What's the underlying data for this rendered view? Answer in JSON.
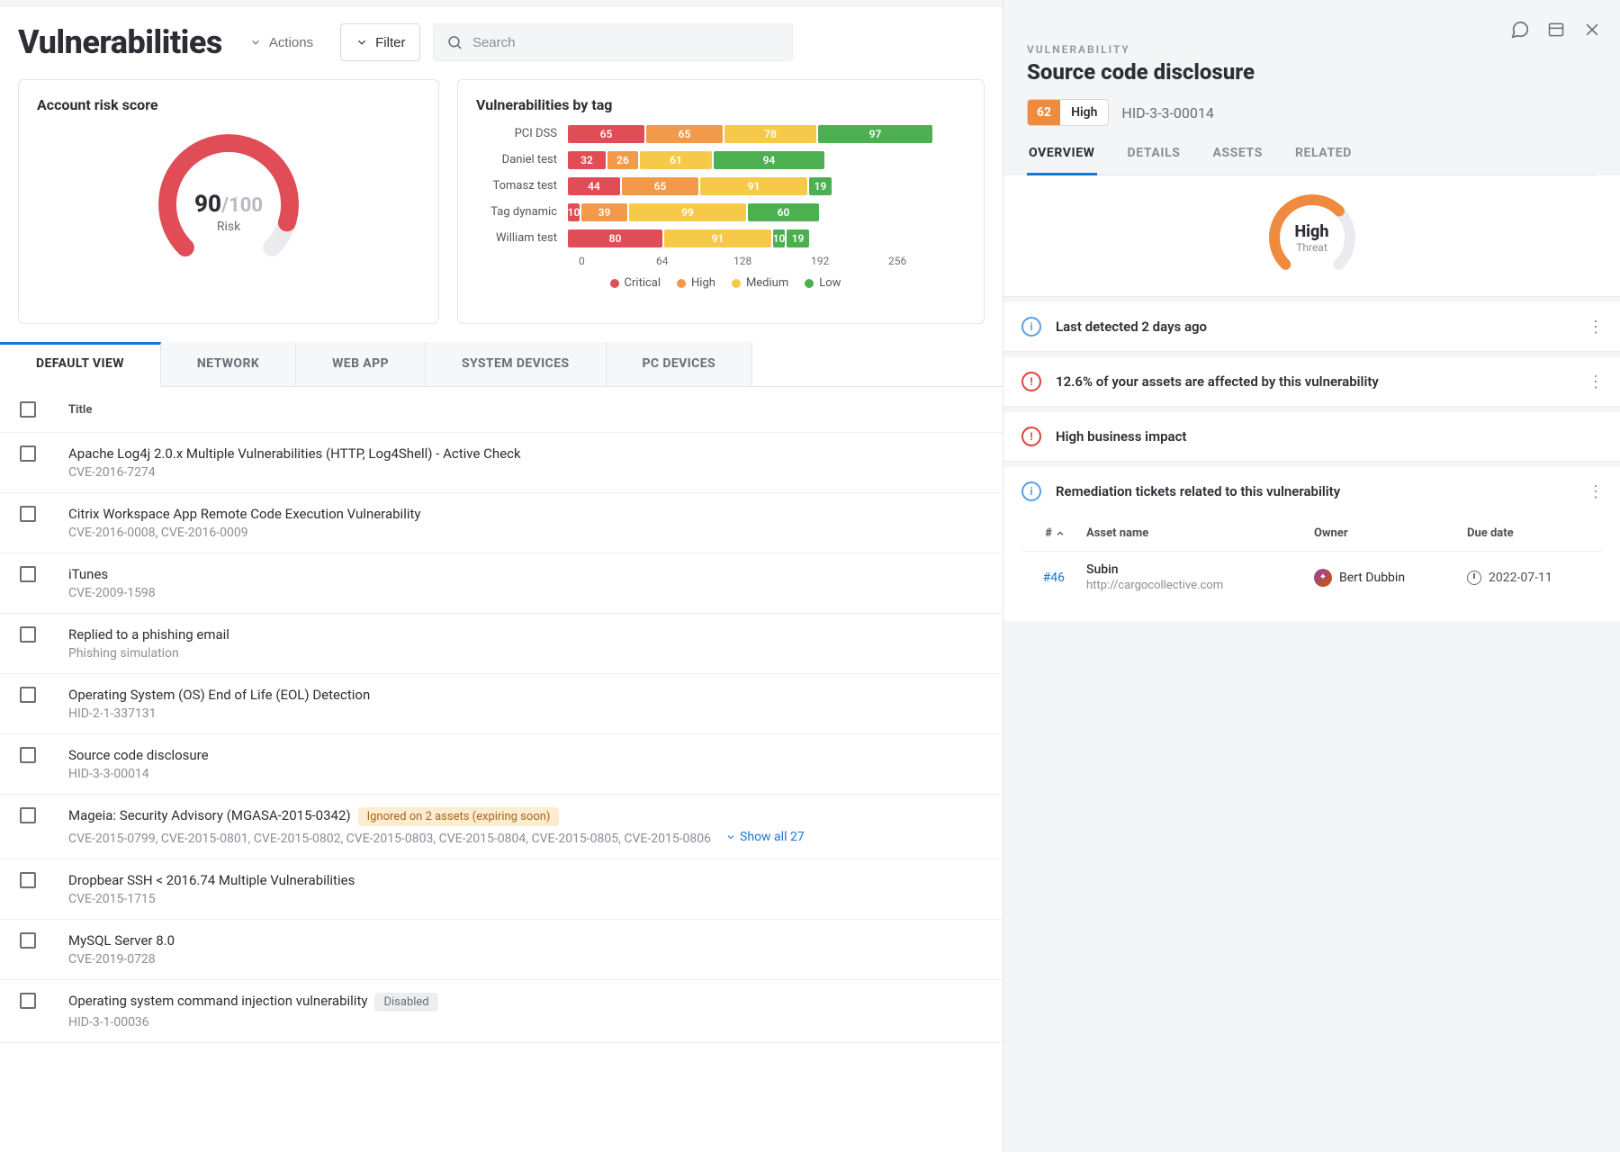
{
  "header": {
    "title": "Vulnerabilities",
    "actions_label": "Actions",
    "filter_label": "Filter",
    "search_placeholder": "Search"
  },
  "risk_card": {
    "title": "Account risk score",
    "score": "90",
    "score_max": "/100",
    "risk_label": "Risk"
  },
  "tags_card": {
    "title": "Vulnerabilities by tag",
    "rows": [
      {
        "label": "PCI DSS",
        "crit": 65,
        "high": 65,
        "med": 78,
        "low": 97
      },
      {
        "label": "Daniel test",
        "crit": 32,
        "high": 26,
        "med": 61,
        "low": 94
      },
      {
        "label": "Tomasz test",
        "crit": 44,
        "high": 65,
        "med": 91,
        "low": 19
      },
      {
        "label": "Tag dynamic",
        "crit": 10,
        "high": 39,
        "med": 99,
        "low": 60
      },
      {
        "label": "William test",
        "crit": 80,
        "high": 0,
        "med": 91,
        "low_a": 10,
        "low_b": 19
      }
    ],
    "axis": [
      "0",
      "64",
      "128",
      "192",
      "256"
    ],
    "legend": {
      "crit": "Critical",
      "high": "High",
      "med": "Medium",
      "low": "Low"
    }
  },
  "chart_data": {
    "type": "bar",
    "stacked": true,
    "orientation": "horizontal",
    "title": "Vulnerabilities by tag",
    "xlabel": "",
    "ylabel": "",
    "xlim": [
      0,
      256
    ],
    "x_ticks": [
      0,
      64,
      128,
      192,
      256
    ],
    "categories": [
      "PCI DSS",
      "Daniel test",
      "Tomasz test",
      "Tag dynamic",
      "William test"
    ],
    "series": [
      {
        "name": "Critical",
        "color": "#e14d57",
        "values": [
          65,
          32,
          44,
          10,
          80
        ]
      },
      {
        "name": "High",
        "color": "#f2994a",
        "values": [
          65,
          26,
          65,
          39,
          0
        ]
      },
      {
        "name": "Medium",
        "color": "#f7c948",
        "values": [
          78,
          61,
          91,
          99,
          91
        ]
      },
      {
        "name": "Low",
        "color": "#4caf50",
        "values": [
          97,
          94,
          19,
          60,
          29
        ]
      }
    ],
    "legend_position": "bottom",
    "note": "William test low segment rendered as two sub-blocks labeled 10 and 19"
  },
  "tabs": {
    "default": "DEFAULT VIEW",
    "network": "NETWORK",
    "webapp": "WEB APP",
    "system": "SYSTEM DEVICES",
    "pc": "PC DEVICES"
  },
  "table": {
    "head_title": "Title",
    "rows": [
      {
        "title": "Apache Log4j 2.0.x Multiple Vulnerabilities (HTTP, Log4Shell) - Active Check",
        "sub": "CVE-2016-7274"
      },
      {
        "title": "Citrix Workspace App Remote Code Execution Vulnerability",
        "sub": "CVE-2016-0008, CVE-2016-0009"
      },
      {
        "title": "iTunes",
        "sub": "CVE-2009-1598"
      },
      {
        "title": "Replied to a phishing email",
        "sub": "Phishing simulation"
      },
      {
        "title": "Operating System (OS) End of Life (EOL) Detection",
        "sub": "HID-2-1-337131"
      },
      {
        "title": "Source code disclosure",
        "sub": "HID-3-3-00014"
      },
      {
        "title": "Mageia: Security Advisory (MGASA-2015-0342)",
        "pill": "Ignored on 2 assets (expiring soon)",
        "pill_type": "warn",
        "sub": "CVE-2015-0799, CVE-2015-0801, CVE-2015-0802, CVE-2015-0803, CVE-2015-0804, CVE-2015-0805, CVE-2015-0806",
        "showall": "Show all 27"
      },
      {
        "title": "Dropbear SSH < 2016.74 Multiple Vulnerabilities",
        "sub": "CVE-2015-1715"
      },
      {
        "title": "MySQL Server 8.0",
        "sub": "CVE-2019-0728"
      },
      {
        "title": "Operating system command injection vulnerability",
        "pill": "Disabled",
        "pill_type": "gray",
        "sub": "HID-3-1-00036"
      }
    ]
  },
  "panel": {
    "eyebrow": "VULNERABILITY",
    "title": "Source code disclosure",
    "sev_num": "62",
    "sev_label": "High",
    "vuln_id": "HID-3-3-00014",
    "tabs": {
      "overview": "OVERVIEW",
      "details": "DETAILS",
      "assets": "ASSETS",
      "related": "RELATED"
    },
    "threat_main": "High",
    "threat_sub": "Threat",
    "info1": "Last detected 2 days ago",
    "info2": "12.6% of your assets are affected by this vulnerability",
    "info3": "High business impact",
    "info4": "Remediation tickets related to this vulnerability",
    "tickets": {
      "head": {
        "num": "#",
        "asset": "Asset name",
        "owner": "Owner",
        "due": "Due date"
      },
      "rows": [
        {
          "id": "#46",
          "asset_name": "Subin",
          "asset_url": "http://cargocollective.com",
          "owner": "Bert Dubbin",
          "due": "2022-07-11"
        }
      ]
    }
  }
}
